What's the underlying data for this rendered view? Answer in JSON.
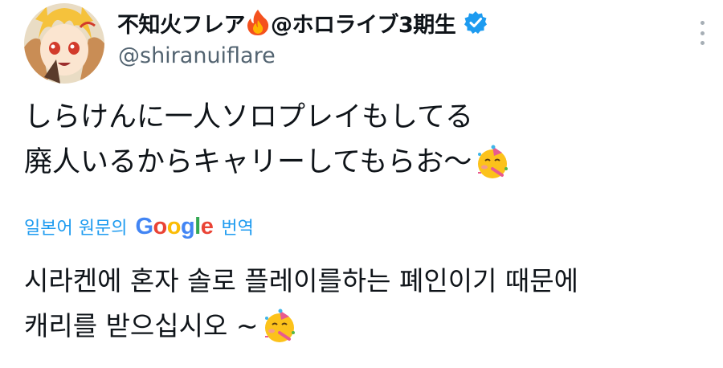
{
  "author": {
    "display_name": "不知火フレア",
    "display_suffix": "@ホロライブ3期生",
    "handle": "@shiranuiflare",
    "verified": true
  },
  "tweet": {
    "lines": [
      "しらけんに一人ソロプレイもしてる",
      "廃人いるからキャリーしてもらお〜"
    ]
  },
  "translation": {
    "label_prefix": "일본어 원문의",
    "brand": [
      "G",
      "o",
      "o",
      "g",
      "l",
      "e"
    ],
    "label_suffix": "번역",
    "lines": [
      "시라켄에 혼자 솔로 플레이를하는 폐인이기 때문에",
      "캐리를 받으십시오 ~"
    ]
  },
  "icons": {
    "flame": "fire-emoji-icon",
    "verified": "verified-badge-icon",
    "more": "more-options-icon",
    "party": "partying-face-emoji-icon"
  },
  "colors": {
    "link": "#1d9bf0",
    "secondary_text": "#536471",
    "verified": "#1d9bf0"
  }
}
